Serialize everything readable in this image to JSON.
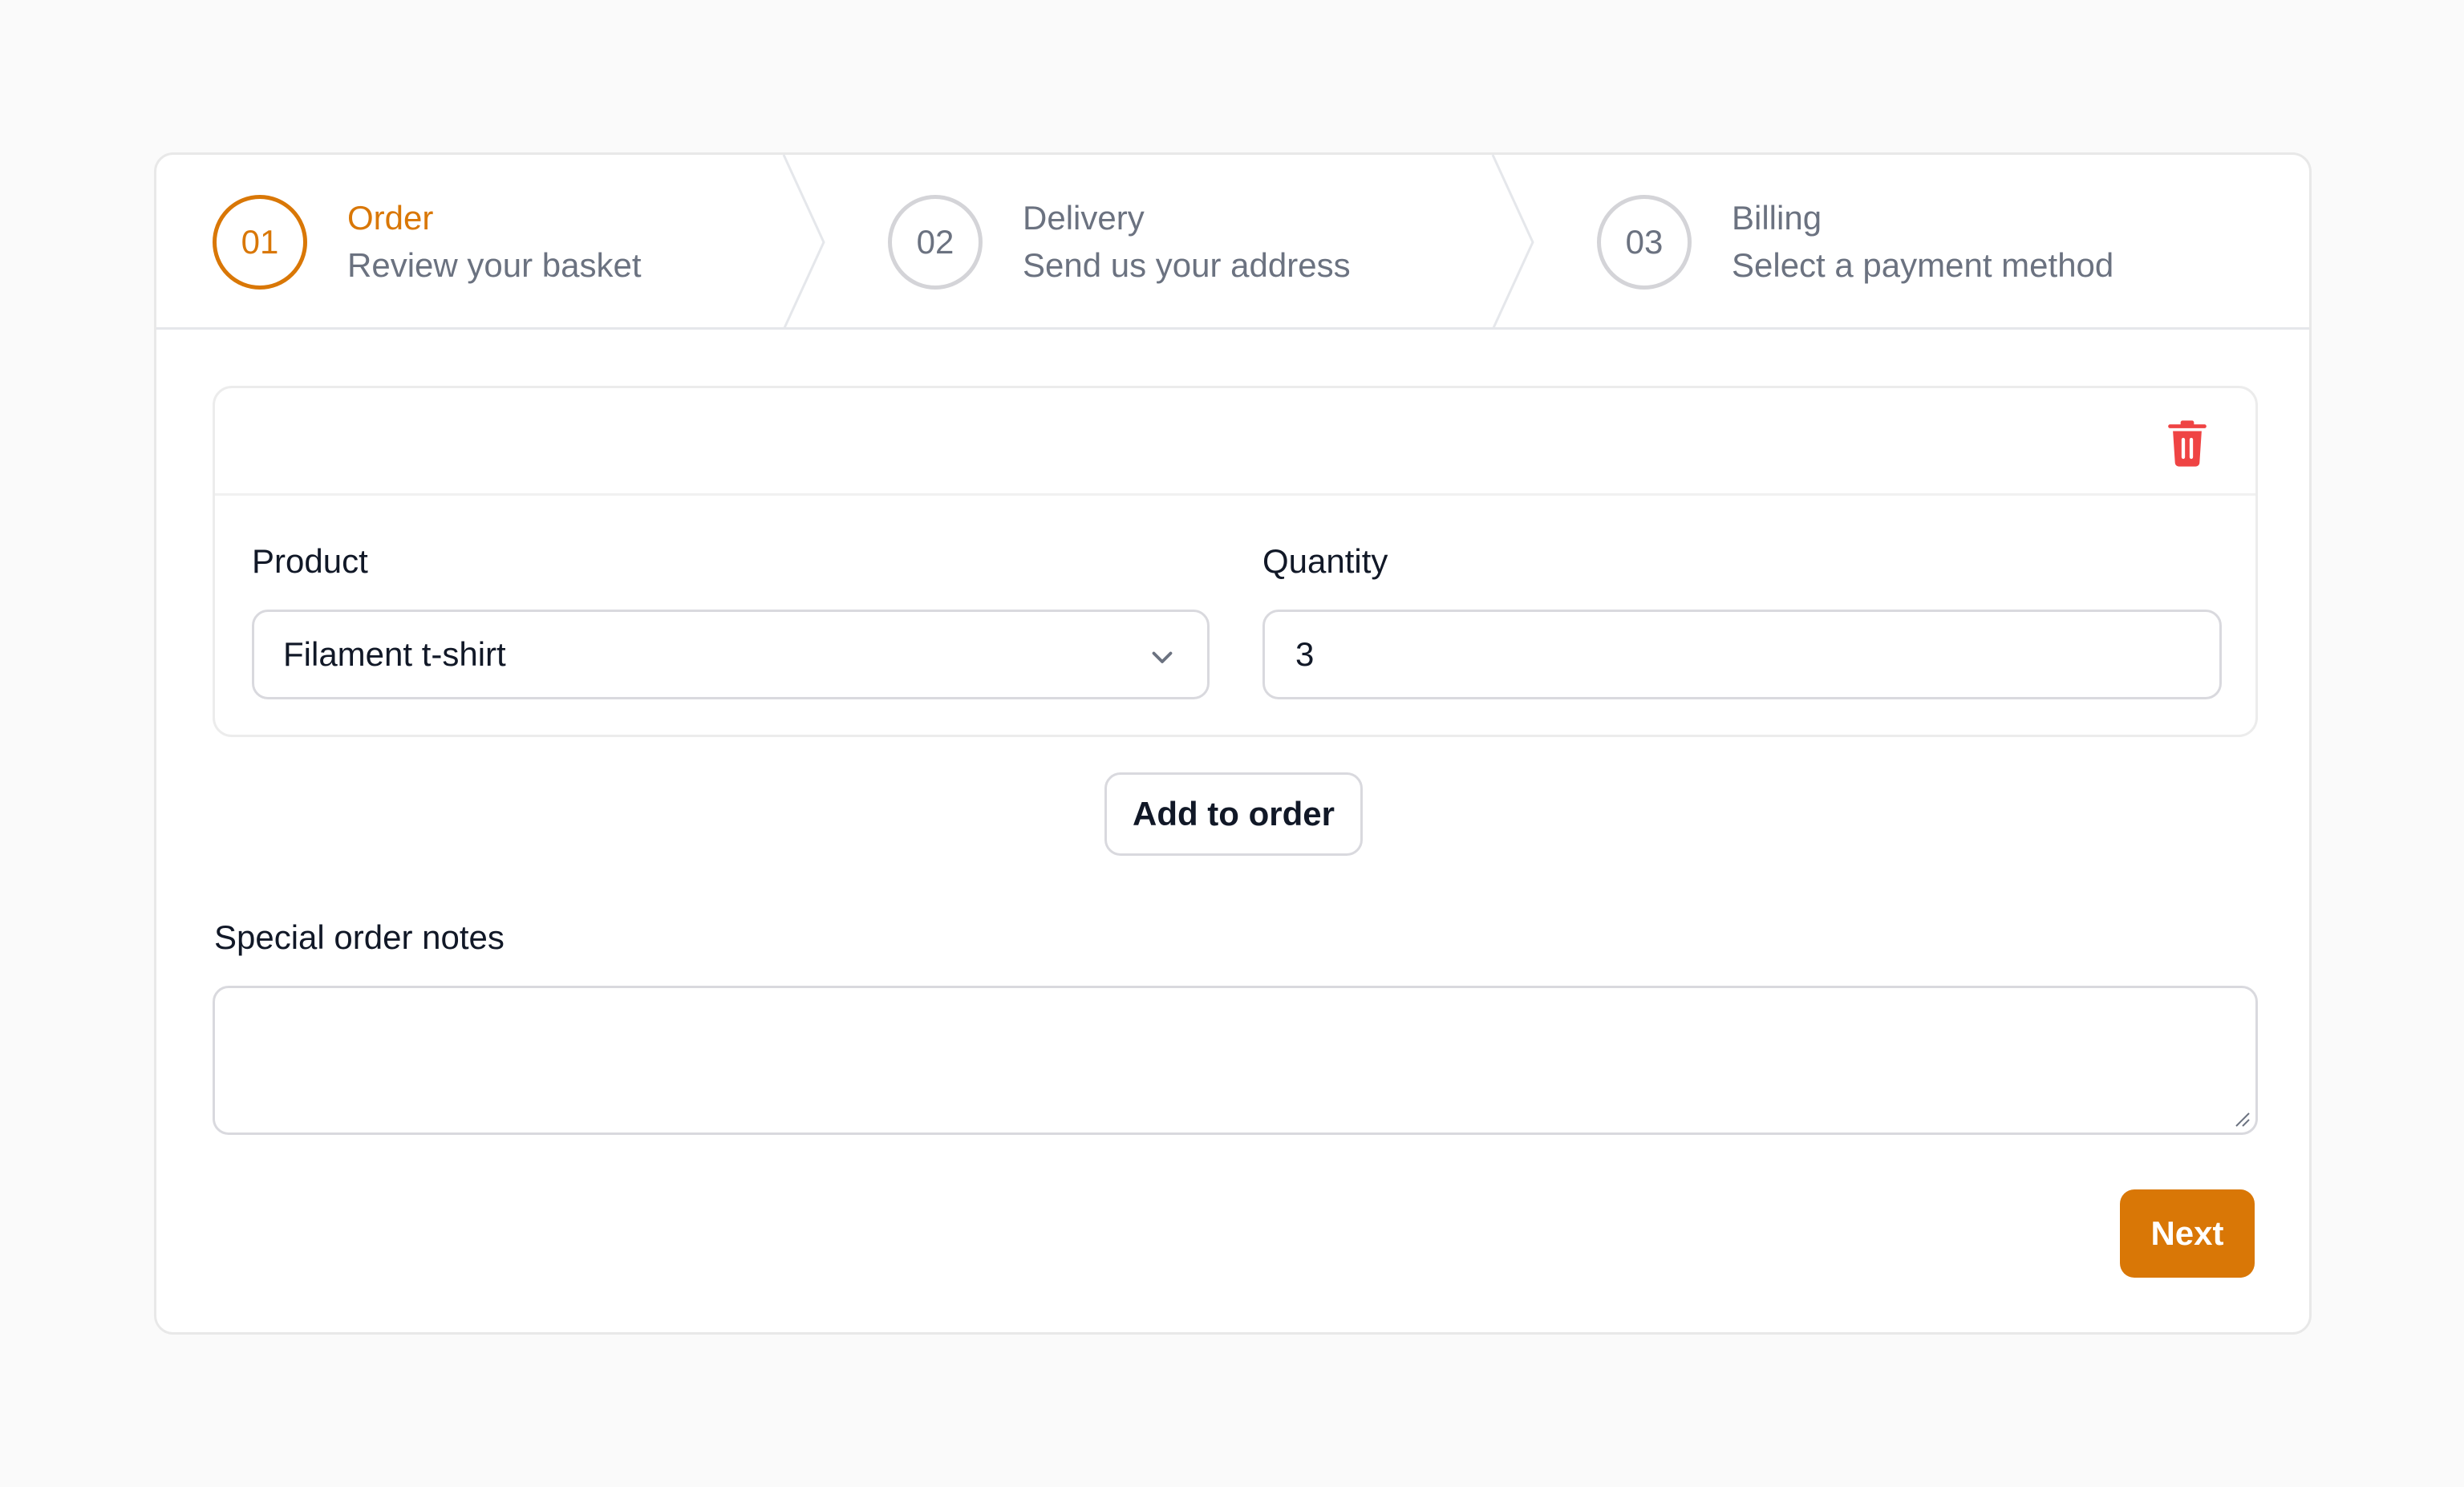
{
  "colors": {
    "accent": "#d97706",
    "danger": "#ef4444",
    "muted_text": "#6b7280",
    "border": "#d9d9de"
  },
  "stepper": {
    "steps": [
      {
        "number": "01",
        "title": "Order",
        "description": "Review your basket",
        "state": "active"
      },
      {
        "number": "02",
        "title": "Delivery",
        "description": "Send us your address",
        "state": "upcoming"
      },
      {
        "number": "03",
        "title": "Billing",
        "description": "Select a payment method",
        "state": "upcoming"
      }
    ]
  },
  "order_item": {
    "delete_icon": "trash-icon",
    "product_label": "Product",
    "product_value": "Filament t-shirt",
    "dropdown_icon": "chevron-down-icon",
    "quantity_label": "Quantity",
    "quantity_value": "3"
  },
  "add_button_label": "Add to order",
  "notes": {
    "label": "Special order notes",
    "value": ""
  },
  "next_button_label": "Next"
}
